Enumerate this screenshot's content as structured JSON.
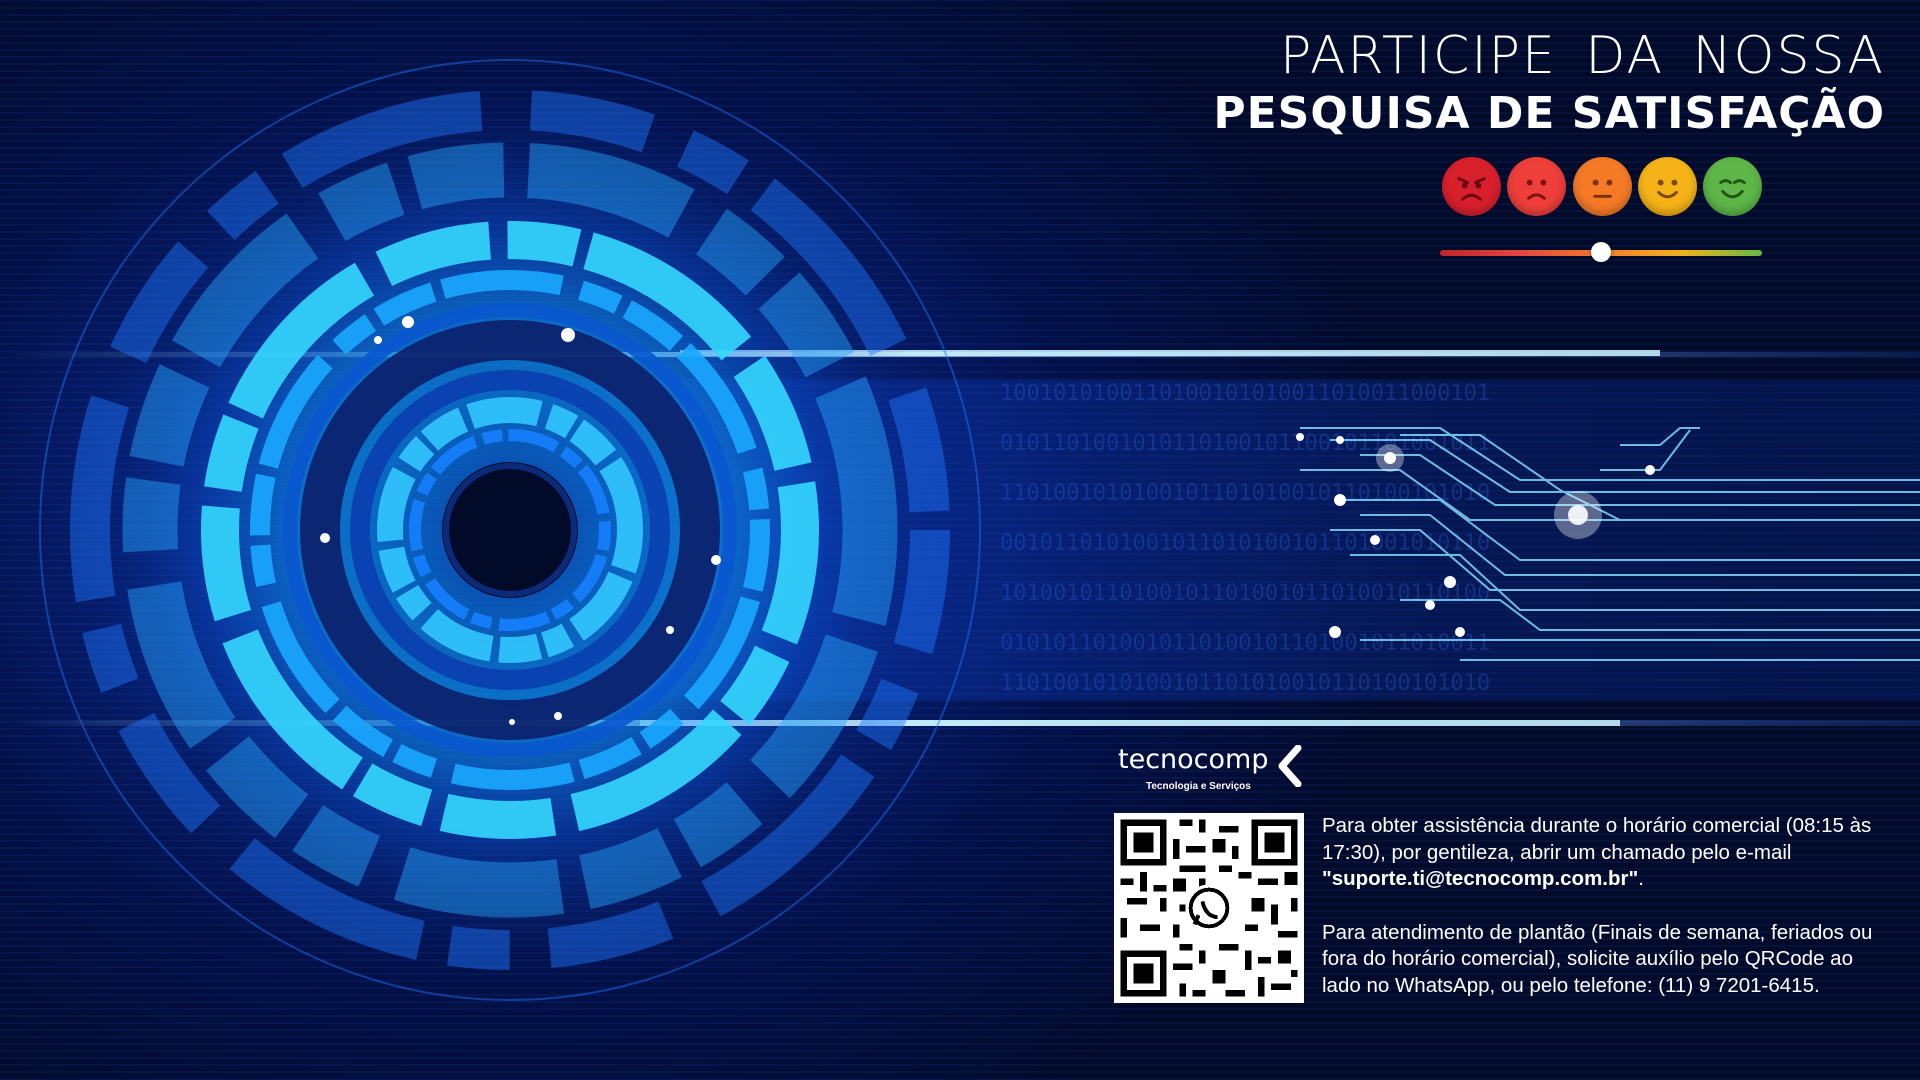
{
  "headline": {
    "line1": "PARTICIPE DA NOSSA",
    "line2": "PESQUISA DE SATISFAÇÃO"
  },
  "rating": {
    "options": [
      {
        "id": "very-dissatisfied",
        "color": "#d8202c"
      },
      {
        "id": "dissatisfied",
        "color": "#ef3f3a"
      },
      {
        "id": "neutral",
        "color": "#f47a26"
      },
      {
        "id": "satisfied",
        "color": "#f6b318"
      },
      {
        "id": "very-satisfied",
        "color": "#5db647"
      }
    ],
    "slider_value": 0.5
  },
  "logo": {
    "wordmark": "tecnocomp",
    "tagline": "Tecnologia e Serviços"
  },
  "qr": {
    "icon": "whatsapp-icon"
  },
  "info": {
    "p1_text": "Para obter assistência durante o horário comercial (08:15 às 17:30), por gentileza, abrir um chamado pelo e-mail ",
    "p1_email": "\"suporte.ti@tecnocomp.com.br\"",
    "p1_end": ".",
    "p2_text": "Para atendimento de plantão (Finais de semana, feriados ou fora do horário comercial), solicite auxílio pelo QRCode ao lado no WhatsApp, ou pelo telefone: (11) 9 7201-6415."
  },
  "colors": {
    "background": "#020a2a",
    "accent_blue": "#19b8ff",
    "text": "#ffffff"
  }
}
